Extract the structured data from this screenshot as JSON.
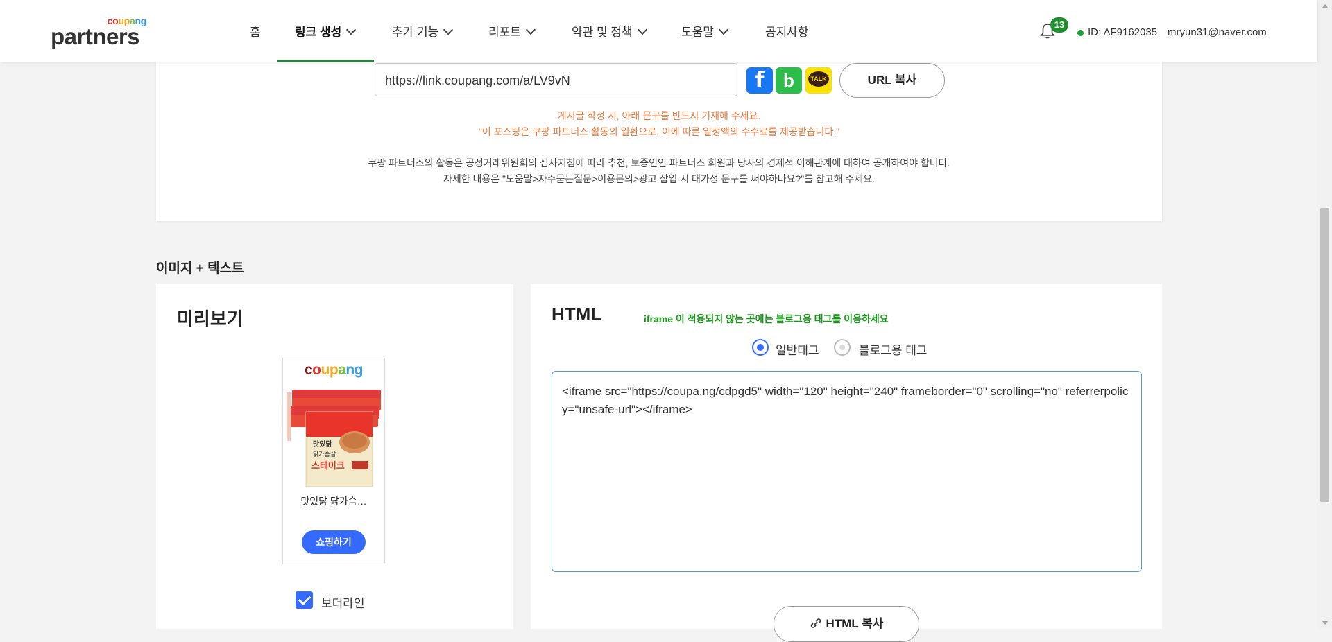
{
  "header": {
    "logo_small": "coupang",
    "logo_big": "partners",
    "nav": [
      {
        "label": "홈",
        "has_chevron": false
      },
      {
        "label": "링크 생성",
        "has_chevron": true,
        "active": true
      },
      {
        "label": "추가 기능",
        "has_chevron": true
      },
      {
        "label": "리포트",
        "has_chevron": true
      },
      {
        "label": "약관 및 정책",
        "has_chevron": true
      },
      {
        "label": "도움말",
        "has_chevron": true
      },
      {
        "label": "공지사항",
        "has_chevron": false
      }
    ],
    "notification_count": "13",
    "user_id": "ID: AF9162035",
    "user_email": "mryun31@naver.com",
    "accent_color": "#1f8a3a"
  },
  "link_card": {
    "short_url": "https://link.coupang.com/a/LV9vN",
    "share_icons": [
      "facebook-icon",
      "band-icon",
      "kakaotalk-icon"
    ],
    "kakao_label": "TALK",
    "url_copy_label": "URL 복사",
    "notice_orange_1": "게시글 작성 시, 아래 문구를 반드시 기재해 주세요.",
    "notice_orange_2": "\"이 포스팅은 쿠팡 파트너스 활동의 일환으로, 이에 따른 일정액의 수수료를 제공받습니다.\"",
    "notice_gray_1": "쿠팡 파트너스의 활동은 공정거래위원회의 심사지침에 따라 추천, 보증인인 파트너스 회원과 당사의 경제적 이해관계에 대하여 공개하여야 합니다.",
    "notice_gray_2": "자세한 내용은 \"도움말>자주묻는질문>이용문의>광고 삽입 시 대가성 문구를 써야하나요?\"를 참고해 주세요."
  },
  "section": {
    "title": "이미지 + 텍스트"
  },
  "preview": {
    "heading": "미리보기",
    "brand": "coupang",
    "product_name": "맛있닭 닭가슴…",
    "shop_button": "쇼핑하기",
    "border_checkbox_label": "보더라인",
    "border_checked": true
  },
  "html_panel": {
    "heading": "HTML",
    "hint": "iframe 이 적용되지 않는 곳에는 블로그용 태그를 이용하세요",
    "radio_normal": "일반태그",
    "radio_blog": "블로그용 태그",
    "selected": "일반태그",
    "code": "<iframe src=\"https://coupa.ng/cdpgd5\" width=\"120\" height=\"240\" frameborder=\"0\" scrolling=\"no\" referrerpolicy=\"unsafe-url\"></iframe>",
    "copy_button": "HTML 복사"
  }
}
